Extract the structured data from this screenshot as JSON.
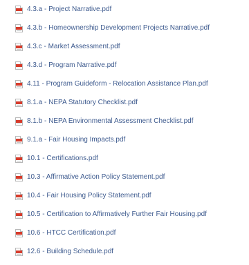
{
  "files": [
    {
      "label": "4.3.a - Project Narrative.pdf",
      "icon": "pdf-file-icon"
    },
    {
      "label": "4.3.b - Homeownership Development Projects Narrative.pdf",
      "icon": "pdf-file-icon"
    },
    {
      "label": "4.3.c - Market Assessment.pdf",
      "icon": "pdf-file-icon"
    },
    {
      "label": "4.3.d - Program Narrative.pdf",
      "icon": "pdf-file-icon"
    },
    {
      "label": "4.11 - Program Guideform - Relocation Assistance Plan.pdf",
      "icon": "pdf-file-icon"
    },
    {
      "label": "8.1.a - NEPA Statutory Checklist.pdf",
      "icon": "pdf-file-icon"
    },
    {
      "label": "8.1.b - NEPA Environmental Assessment Checklist.pdf",
      "icon": "pdf-file-icon"
    },
    {
      "label": "9.1.a - Fair Housing Impacts.pdf",
      "icon": "pdf-file-icon"
    },
    {
      "label": "10.1 - Certifications.pdf",
      "icon": "pdf-file-icon"
    },
    {
      "label": "10.3 - Affirmative Action Policy Statement.pdf",
      "icon": "pdf-file-icon"
    },
    {
      "label": "10.4 - Fair Housing Policy Statement.pdf",
      "icon": "pdf-file-icon"
    },
    {
      "label": "10.5 - Certification to Affirmatively Further Fair Housing.pdf",
      "icon": "pdf-file-icon"
    },
    {
      "label": "10.6 - HTCC Certification.pdf",
      "icon": "pdf-file-icon"
    },
    {
      "label": "12.6 - Building Schedule.pdf",
      "icon": "pdf-file-icon"
    }
  ],
  "colors": {
    "link": "#3d5a8e",
    "pdf_red": "#d63a2a",
    "background": "#ffffff"
  }
}
